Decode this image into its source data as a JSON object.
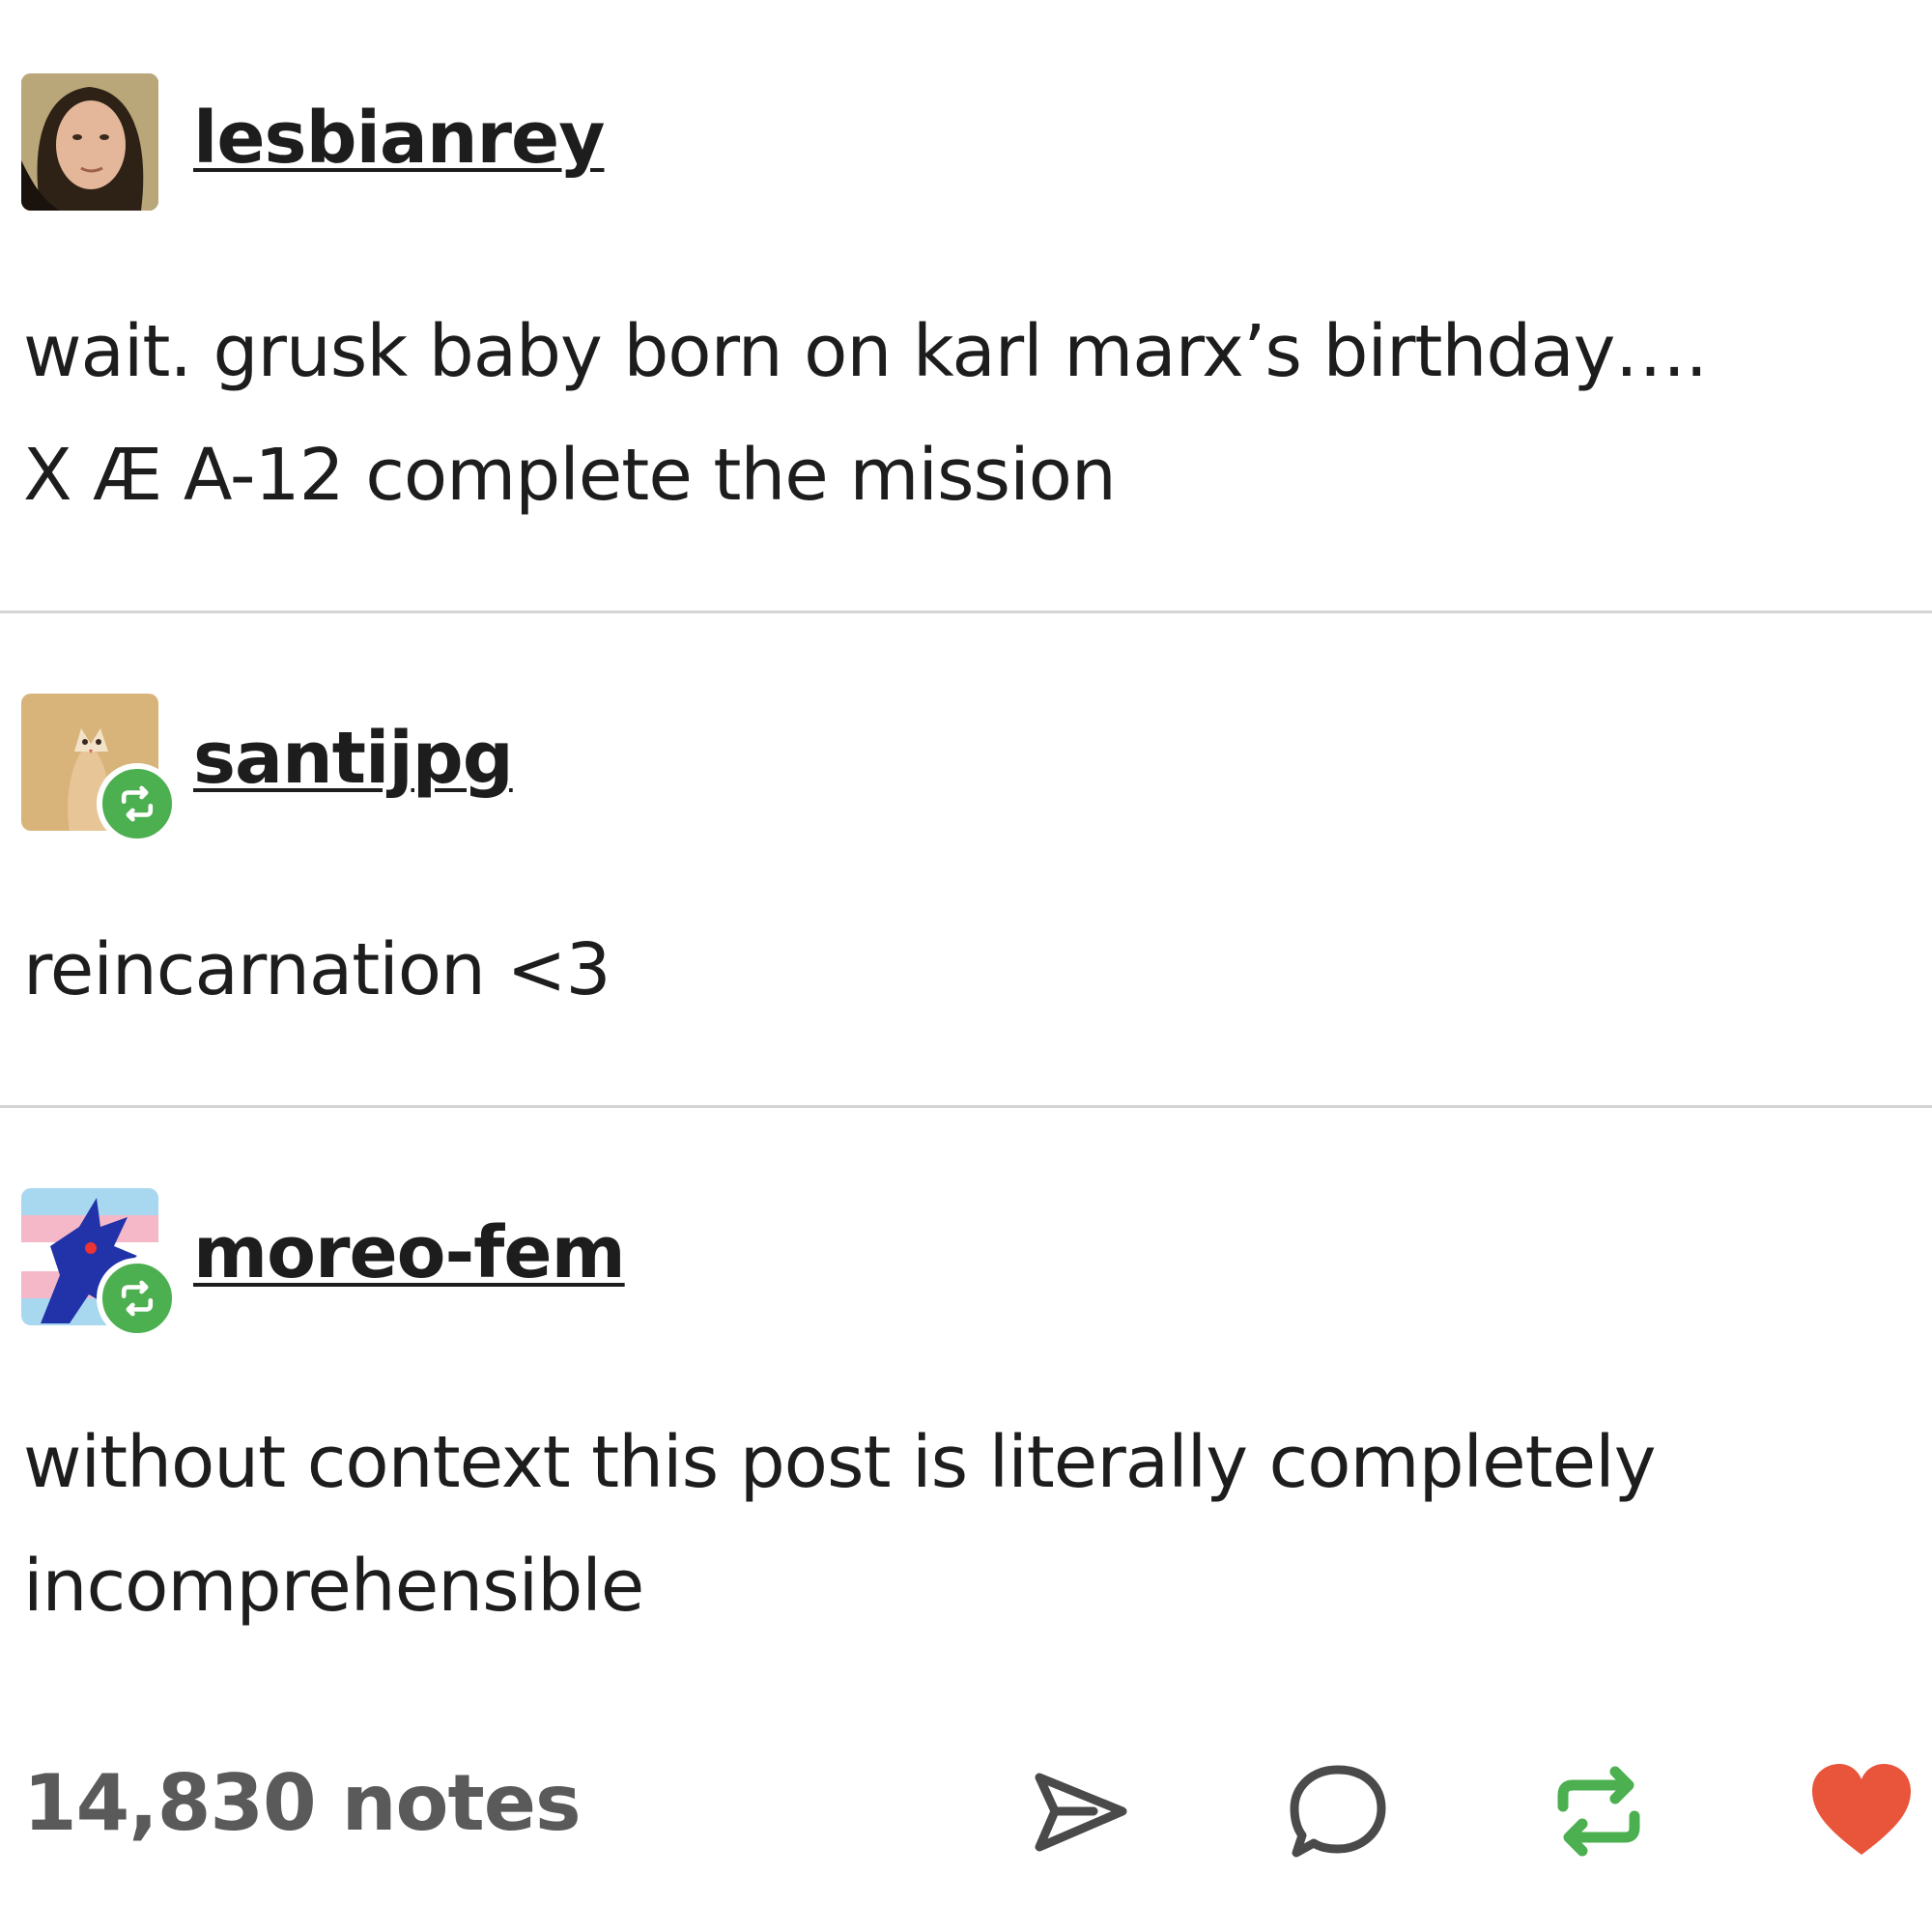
{
  "posts": [
    {
      "username": "lesbianrey",
      "reblog": false,
      "lines": [
        "wait. grusk baby born on karl marx’s birthday….",
        "X Æ A-12 complete the mission"
      ]
    },
    {
      "username": "santijpg",
      "reblog": true,
      "lines": [
        "reincarnation <3"
      ]
    },
    {
      "username": "moreo-fem",
      "reblog": true,
      "lines": [
        "without context this post is literally completely",
        "incomprehensible"
      ]
    }
  ],
  "footer": {
    "notes": "14,830 notes",
    "actions": {
      "share_icon": "share-icon",
      "reply_icon": "reply-icon",
      "reblog_icon": "reblog-icon",
      "like_icon": "like-icon"
    }
  },
  "colors": {
    "reblog_green": "#4caf50",
    "like_red": "#e8553b",
    "divider": "#d4d4d4",
    "notes_gray": "#5a5a5a"
  }
}
